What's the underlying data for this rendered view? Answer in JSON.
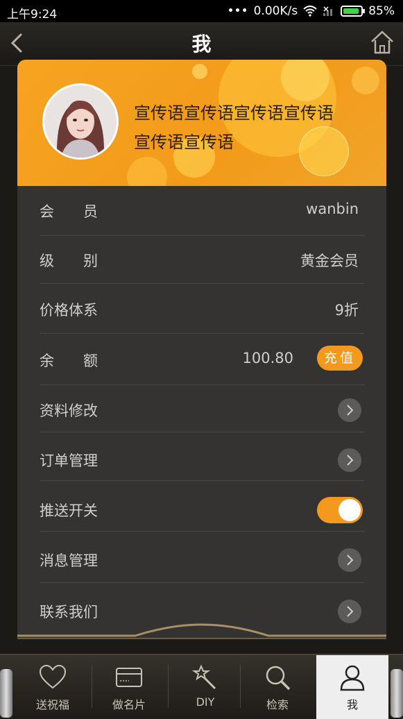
{
  "status": {
    "time": "上午9:24",
    "speed": "0.00K/s",
    "battery": "85%"
  },
  "nav": {
    "title": "我"
  },
  "profile": {
    "slogan": "宣传语宣传语宣传语宣传语宣传语宣传语"
  },
  "rows": {
    "member": {
      "label": "会　　员",
      "value": "wanbin"
    },
    "level": {
      "label": "级　　别",
      "value": "黄金会员"
    },
    "price": {
      "label": "价格体系",
      "value": "9折"
    },
    "balance": {
      "label": "余　　额",
      "value": "100.80",
      "button": "充值"
    },
    "edit_profile": {
      "label": "资料修改"
    },
    "orders": {
      "label": "订单管理"
    },
    "push": {
      "label": "推送开关",
      "enabled": true
    },
    "messages": {
      "label": "消息管理"
    },
    "contact": {
      "label": "联系我们"
    }
  },
  "tabs": [
    {
      "label": "送祝福",
      "icon": "heart-icon"
    },
    {
      "label": "做名片",
      "icon": "card-icon"
    },
    {
      "label": "DIY",
      "icon": "magic-wand-icon"
    },
    {
      "label": "检索",
      "icon": "search-icon"
    },
    {
      "label": "我",
      "icon": "user-icon",
      "active": true
    }
  ],
  "colors": {
    "accent": "#f39a1e",
    "panel": "#343332",
    "background": "#1b1a17"
  }
}
